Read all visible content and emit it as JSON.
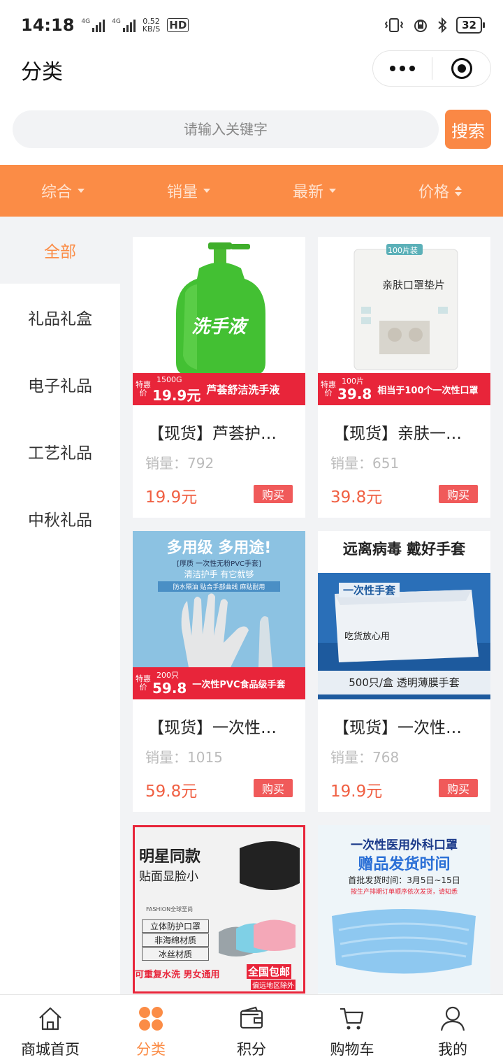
{
  "status": {
    "time": "14:18",
    "signal_tag": "4G",
    "speed_value": "0.52",
    "speed_unit": "KB/S",
    "hd": "HD",
    "battery": "32"
  },
  "header": {
    "title": "分类"
  },
  "search": {
    "placeholder": "请输入关键字",
    "button_label": "搜索"
  },
  "sort_bar": [
    {
      "label": "综合"
    },
    {
      "label": "销量"
    },
    {
      "label": "最新"
    },
    {
      "label": "价格"
    }
  ],
  "sidebar": {
    "items": [
      {
        "label": "全部"
      },
      {
        "label": "礼品礼盒"
      },
      {
        "label": "电子礼品"
      },
      {
        "label": "工艺礼品"
      },
      {
        "label": "中秋礼品"
      }
    ]
  },
  "products": [
    {
      "name": "【现货】芦荟护…",
      "sales": "销量：792",
      "price": "19.9元",
      "buy_label": "购买",
      "image": {
        "headline": "洗手液",
        "promo_tag": "特惠价",
        "promo_qty": "1500G",
        "promo_price": "19.9元",
        "promo_text": "芦荟舒洁洗手液"
      }
    },
    {
      "name": "【现货】亲肤一…",
      "sales": "销量：651",
      "price": "39.8元",
      "buy_label": "购买",
      "image": {
        "headline": "亲肤口罩垫片",
        "badge": "100片装",
        "promo_tag": "特惠价",
        "promo_qty": "100片",
        "promo_price": "39.8",
        "promo_text": "相当于100个一次性口罩"
      }
    },
    {
      "name": "【现货】一次性…",
      "sales": "销量：1015",
      "price": "59.8元",
      "buy_label": "购买",
      "image": {
        "headline": "多用级 多用途!",
        "sub1": "[厚质 一次性无粉PVC手套]",
        "sub2": "清洁护手 有它就够",
        "sub3": "防水隔油 贴合手部曲线 麻贴耐用",
        "promo_tag": "特惠价",
        "promo_qty": "200只",
        "promo_price": "59.8",
        "promo_text": "一次性PVC食品级手套"
      }
    },
    {
      "name": "【现货】一次性…",
      "sales": "销量：768",
      "price": "19.9元",
      "buy_label": "购买",
      "image": {
        "headline": "远离病毒 戴好手套",
        "box_text": "一次性手套",
        "box_brand": "吃货放心用",
        "footer": "500只/盒 透明薄膜手套"
      }
    },
    {
      "name": "",
      "sales": "",
      "price": "",
      "buy_label": "",
      "image": {
        "headline": "明星同款",
        "sub1": "贴面显脸小",
        "fashion": "FASHION全球至尚",
        "feature1": "立体防护口罩",
        "feature2": "非海绵材质",
        "feature3": "冰丝材质",
        "footer1": "可重复水洗 男女通用",
        "footer2": "全国包邮",
        "footer3": "偏远地区除外"
      }
    },
    {
      "name": "",
      "sales": "",
      "price": "",
      "buy_label": "",
      "image": {
        "headline": "一次性医用外科口罩",
        "sub1": "赠品发货时间",
        "sub2": "首批发货时间：3月5日~15日",
        "sub3": "按生产排期订单顺序依次发货，请知悉"
      }
    }
  ],
  "tab_bar": [
    {
      "label": "商城首页",
      "icon": "home-icon"
    },
    {
      "label": "分类",
      "icon": "category-icon"
    },
    {
      "label": "积分",
      "icon": "wallet-icon"
    },
    {
      "label": "购物车",
      "icon": "cart-icon"
    },
    {
      "label": "我的",
      "icon": "user-icon"
    }
  ],
  "colors": {
    "accent": "#fb8c46",
    "price": "#f05f42",
    "buy": "#f05a5a",
    "promo": "#e8253a"
  }
}
